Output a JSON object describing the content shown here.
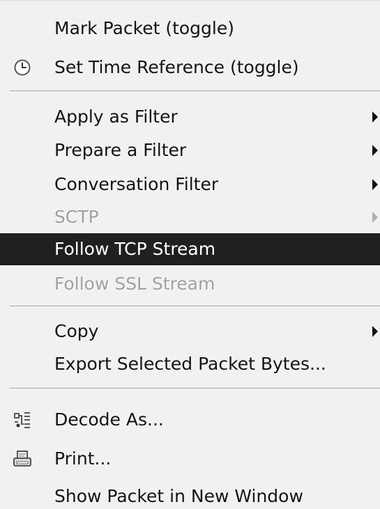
{
  "menu": {
    "mark_packet": "Mark Packet (toggle)",
    "set_time_reference": "Set Time Reference (toggle)",
    "apply_as_filter": "Apply as Filter",
    "prepare_a_filter": "Prepare a Filter",
    "conversation_filter": "Conversation Filter",
    "sctp": "SCTP",
    "follow_tcp_stream": "Follow TCP Stream",
    "follow_ssl_stream": "Follow SSL Stream",
    "copy": "Copy",
    "export_selected_packet_bytes": "Export Selected Packet Bytes...",
    "decode_as": "Decode As...",
    "print": "Print...",
    "show_packet_in_new_window": "Show Packet in New Window"
  },
  "icons": {
    "set_time_reference": "clock-icon",
    "decode_as": "decode-icon",
    "print": "printer-icon",
    "submenu": "submenu-arrow-icon"
  },
  "colors": {
    "menu_background": "#f1f1f1",
    "highlight_background": "#202020",
    "highlight_text": "#ffffff",
    "disabled_text": "#a0a0a0"
  },
  "state": {
    "highlighted_item": "Follow TCP Stream",
    "disabled_items": [
      "SCTP",
      "Follow SSL Stream"
    ]
  }
}
